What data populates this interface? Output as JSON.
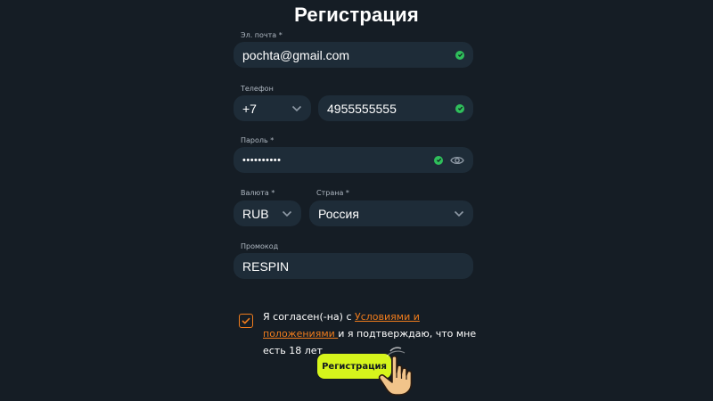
{
  "page": {
    "title": "Регистрация"
  },
  "email": {
    "label": "Эл. почта *",
    "value": "pochta@gmail.com",
    "valid": true
  },
  "phone": {
    "label": "Телефон",
    "code": "+7",
    "value": "4955555555",
    "valid": true
  },
  "password": {
    "label": "Пароль *",
    "value": "••••••••••",
    "valid": true
  },
  "currency": {
    "label": "Валюта *",
    "value": "RUB"
  },
  "country": {
    "label": "Страна *",
    "value": "Россия"
  },
  "promo": {
    "label": "Промокод",
    "value": "RESPIN"
  },
  "consent": {
    "checked": true,
    "text_before": "Я согласен(-на) с ",
    "link_text": "Условиями и положениями ",
    "text_after": "и я подтверждаю, что мне есть 18 лет"
  },
  "submit": {
    "label": "Регистрация"
  },
  "colors": {
    "background": "#151d25",
    "field": "#1e2c38",
    "accent_orange": "#f07c1c",
    "valid_green": "#2fbf5b",
    "button_lime": "#d6f51c"
  },
  "icons": {
    "valid": "check-circle-icon",
    "dropdown": "chevron-down-icon",
    "reveal": "eye-icon",
    "pointer": "pointing-hand-icon"
  }
}
